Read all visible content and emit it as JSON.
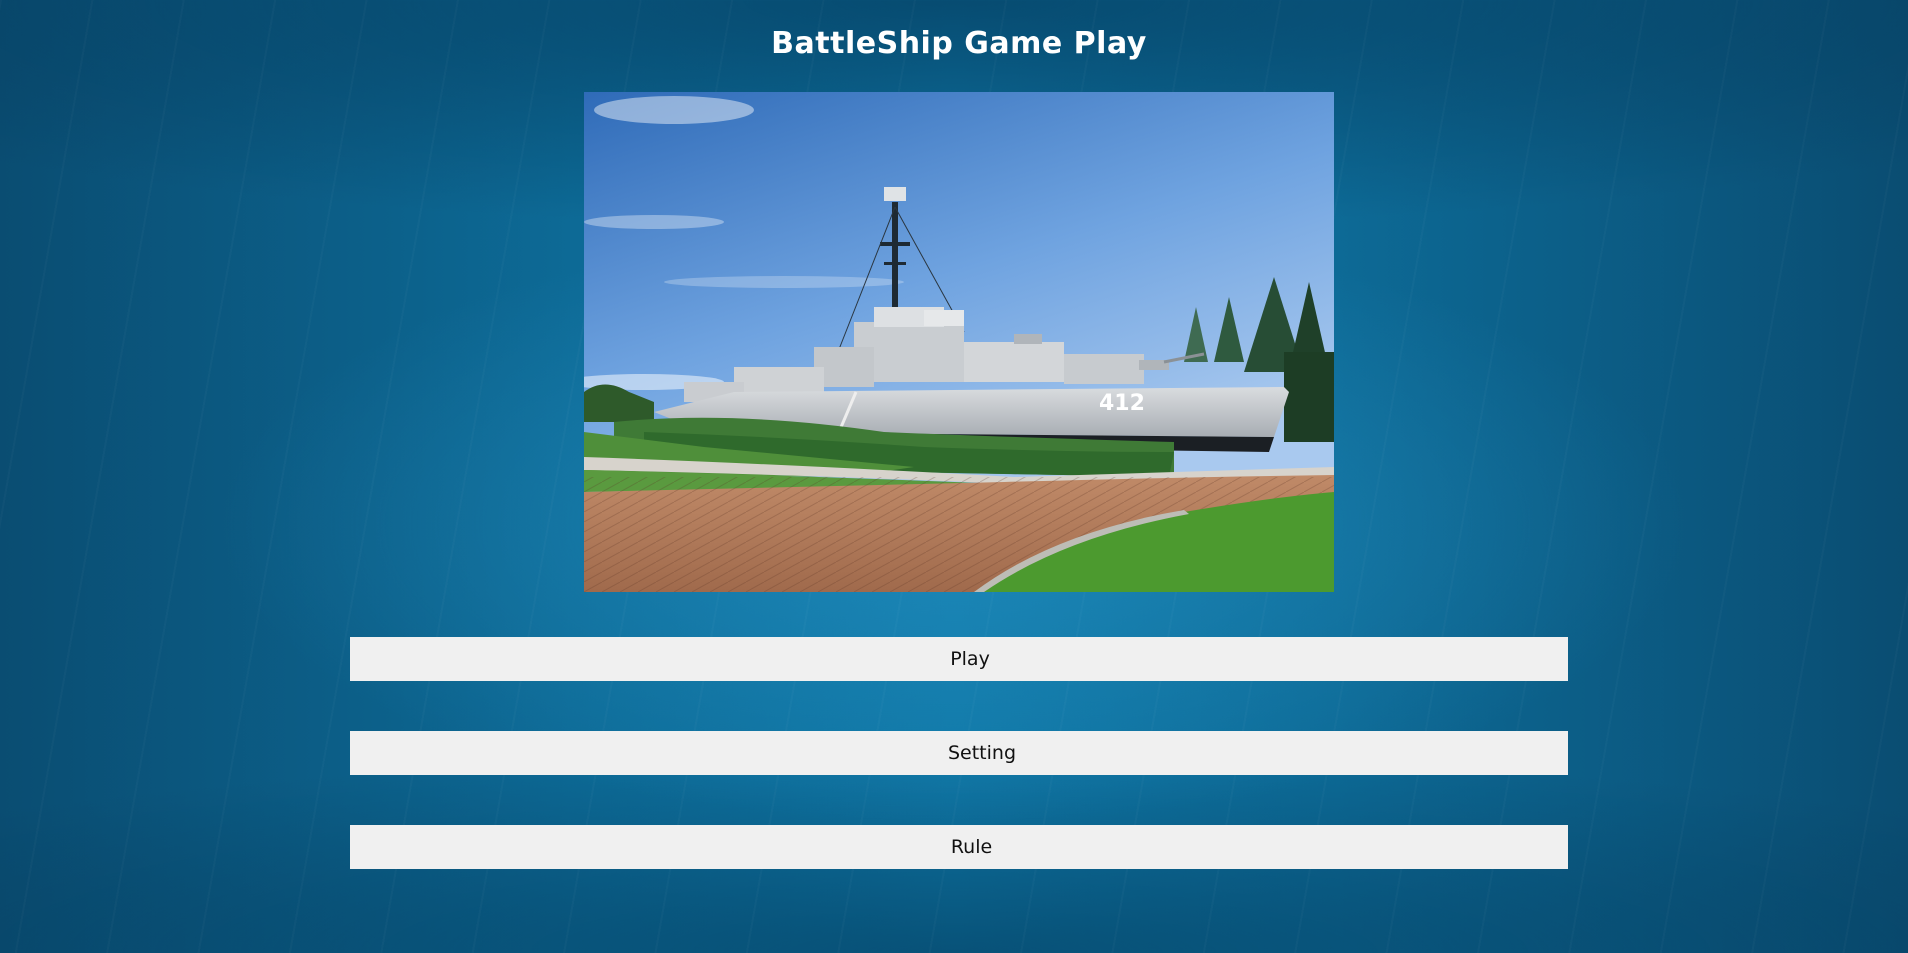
{
  "page": {
    "title": "BattleShip Game Play"
  },
  "hero_image": {
    "hull_number": "412"
  },
  "menu": {
    "play_label": "Play",
    "setting_label": "Setting",
    "rule_label": "Rule"
  }
}
